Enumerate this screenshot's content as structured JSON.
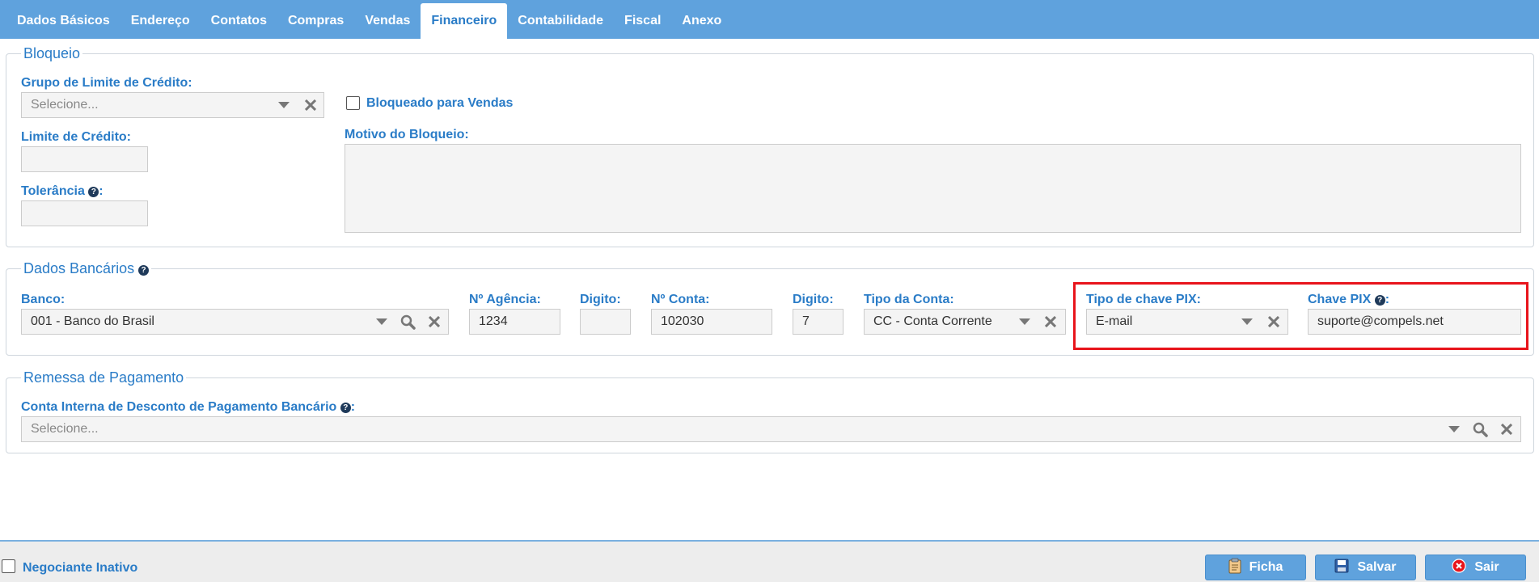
{
  "tabs": [
    {
      "label": "Dados Básicos"
    },
    {
      "label": "Endereço"
    },
    {
      "label": "Contatos"
    },
    {
      "label": "Compras"
    },
    {
      "label": "Vendas"
    },
    {
      "label": "Financeiro",
      "active": true
    },
    {
      "label": "Contabilidade"
    },
    {
      "label": "Fiscal"
    },
    {
      "label": "Anexo"
    }
  ],
  "bloqueio": {
    "legend": "Bloqueio",
    "grupo_label": "Grupo de Limite de Crédito:",
    "grupo_placeholder": "Selecione...",
    "limite_label": "Limite de Crédito:",
    "limite_value": "",
    "tolerancia_label": "Tolerância",
    "tolerancia_colon": ":",
    "tolerancia_value": "",
    "bloqueado_label": "Bloqueado para Vendas",
    "bloqueado_checked": false,
    "motivo_label": "Motivo do Bloqueio:",
    "motivo_value": ""
  },
  "bancarios": {
    "legend": "Dados Bancários",
    "banco_label": "Banco:",
    "banco_value": "001 - Banco do Brasil",
    "agencia_label": "Nº Agência:",
    "agencia_value": "1234",
    "digito1_label": "Digito:",
    "digito1_value": "",
    "conta_label": "Nº Conta:",
    "conta_value": "102030",
    "digito2_label": "Digito:",
    "digito2_value": "7",
    "tipo_conta_label": "Tipo da Conta:",
    "tipo_conta_value": "CC - Conta Corrente",
    "tipo_pix_label": "Tipo de chave PIX:",
    "tipo_pix_value": "E-mail",
    "chave_pix_label": "Chave PIX",
    "chave_pix_colon": ":",
    "chave_pix_value": "suporte@compels.net"
  },
  "remessa": {
    "legend": "Remessa de Pagamento",
    "conta_label": "Conta Interna de Desconto de Pagamento Bancário",
    "conta_colon": ":",
    "conta_placeholder": "Selecione..."
  },
  "footer": {
    "inativo_label": "Negociante Inativo",
    "inativo_checked": false,
    "ficha_label": "Ficha",
    "salvar_label": "Salvar",
    "sair_label": "Sair"
  },
  "help_glyph": "?",
  "colors": {
    "accent": "#5fa2dd",
    "label_blue": "#2a7cc7",
    "highlight_red": "#e8141b",
    "sair_icon_red": "#e8141b"
  },
  "icons": {
    "dropdown": "caret-down-icon",
    "clear": "close-x-icon",
    "search": "search-icon",
    "help": "question-circle-icon",
    "ficha": "clipboard-icon",
    "salvar": "floppy-disk-icon",
    "sair": "close-circle-icon"
  }
}
